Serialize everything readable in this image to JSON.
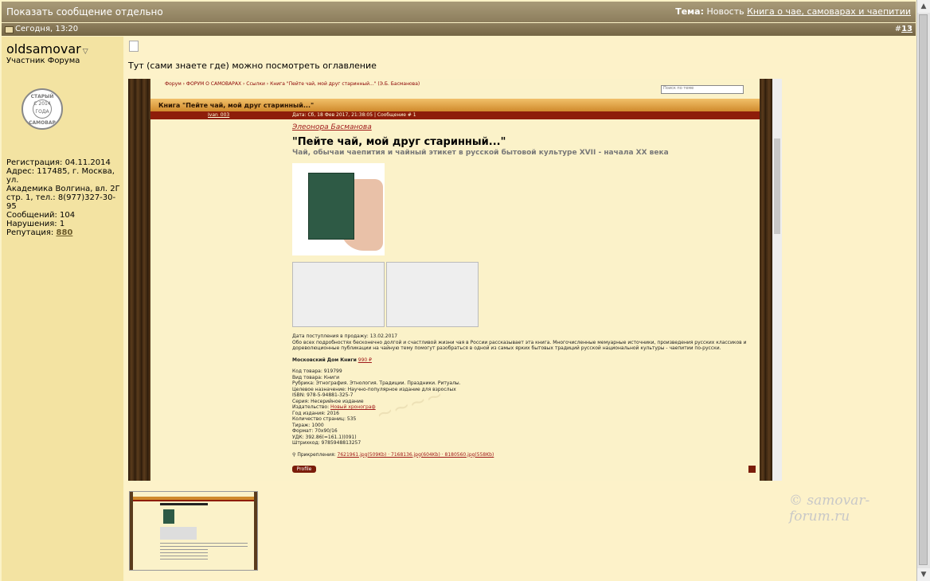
{
  "top_bar": {
    "left_title": "Показать сообщение отдельно",
    "topic_label": "Тема:",
    "topic_prefix": "Новость",
    "topic_link": "Книга о чае, самоварах и чаепитии"
  },
  "post_header": {
    "date": "Сегодня, 13:20",
    "hash": "#",
    "number": "13"
  },
  "user": {
    "name": "oldsamovar",
    "role": "Участник Форума",
    "avatar_top": "СТАРЫЙ",
    "avatar_mid": "С 2014 ГОДА",
    "avatar_bottom": "САМОВАР",
    "info_lines": [
      "Регистрация: 04.11.2014",
      "Адрес: 117485, г. Москва, ул.",
      "Академика Волгина, вл. 2Г",
      "стр. 1, тел.: 8(977)327-30-95",
      "Сообщений: 104",
      "Нарушения: 1"
    ],
    "reputation_label": "Репутация:",
    "reputation_value": "880"
  },
  "post": {
    "text": "Тут (сами знаете где) можно посмотреть оглавление"
  },
  "embedded": {
    "breadcrumbs": "Форум › ФОРУМ О САМОВАРАХ › Ссылки › Книга \"Пейте чай, мой друг старинный...\" (Э.Б. Басманова)",
    "search_placeholder": "Поиск по теме",
    "thread_title": "Книга \"Пейте чай, мой друг старинный...\"",
    "post_user": "Ivan_003",
    "post_date": "Дата: Сб, 18 Фев 2017, 21:38:05 | Сообщение # 1",
    "author": "Элеонора Басманова",
    "book_title": "\"Пейте чай, мой друг старинный...\"",
    "book_subtitle": "Чай, обычаи чаепития и чайный этикет в русской бытовой культуре XVII - начала XX века",
    "release": "Дата поступления в продажу: 13.02.2017",
    "desc1": "Обо всех подробностях бесконечно долгой и счастливой жизни чая в России рассказывает эта книга. Многочисленные мемуарные источники, произведения русских классиков и",
    "desc2": "дореволюционные публикации на чайную тему помогут разобраться в одной из самых ярких бытовых традиций русской национальной культуры - чаепитии по-русски.",
    "store": "Московский Дом Книги",
    "price": "990 ₽",
    "details": [
      "Код товара: 919799",
      "Вид товара: Книги",
      "Рубрика: Этнография. Этнология. Традиции. Праздники. Ритуалы.",
      "Целевое назначение: Научно-популярное издание для взрослых",
      "ISBN: 978-5-94881-325-7",
      "Серия: Несерийное издание"
    ],
    "publisher_label": "Издательство:",
    "publisher": "Новый хронограф",
    "details2": [
      "Год издания: 2016",
      "Количество страниц: 535",
      "Тираж: 1000",
      "Формат: 70x90/16",
      "УДК: 392.86(=161.1)(091)",
      "Штрихкод: 9785948813257"
    ],
    "attachments_label": "Прикрепления:",
    "attachments": "7621961.jpg(509Kb) · 7168136.jpg(604Kb) · 8180560.jpg(558Kb)",
    "profile_button": "Profile"
  },
  "watermark": "© samovar-forum.ru"
}
